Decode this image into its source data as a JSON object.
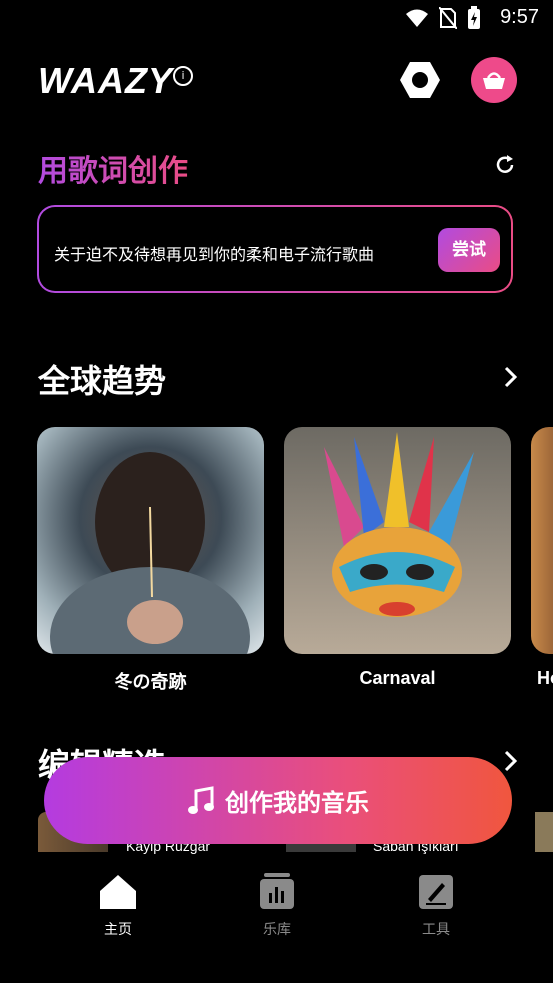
{
  "status_bar": {
    "time": "9:57"
  },
  "header": {
    "logo": "WAAZY",
    "info_icon": "i"
  },
  "lyrics_section": {
    "title": "用歌词创作",
    "prompt": "关于迫不及待想再见到你的柔和电子流行歌曲",
    "try_label": "尝试"
  },
  "trending": {
    "title": "全球趋势",
    "cards": [
      {
        "title": "冬の奇跡"
      },
      {
        "title": "Carnaval"
      },
      {
        "title": "Ho"
      }
    ]
  },
  "editor_picks": {
    "title": "编辑精选",
    "items": [
      {
        "title": "Kayip Ruzgar"
      },
      {
        "title": "Saban Işıkları"
      }
    ]
  },
  "create_button": {
    "label": "创作我的音乐"
  },
  "nav": {
    "items": [
      {
        "label": "主页",
        "active": true
      },
      {
        "label": "乐库",
        "active": false
      },
      {
        "label": "工具",
        "active": false
      }
    ]
  },
  "colors": {
    "accent_start": "#b14be0",
    "accent_end": "#ea4c85",
    "basket": "#ee4a8a"
  }
}
